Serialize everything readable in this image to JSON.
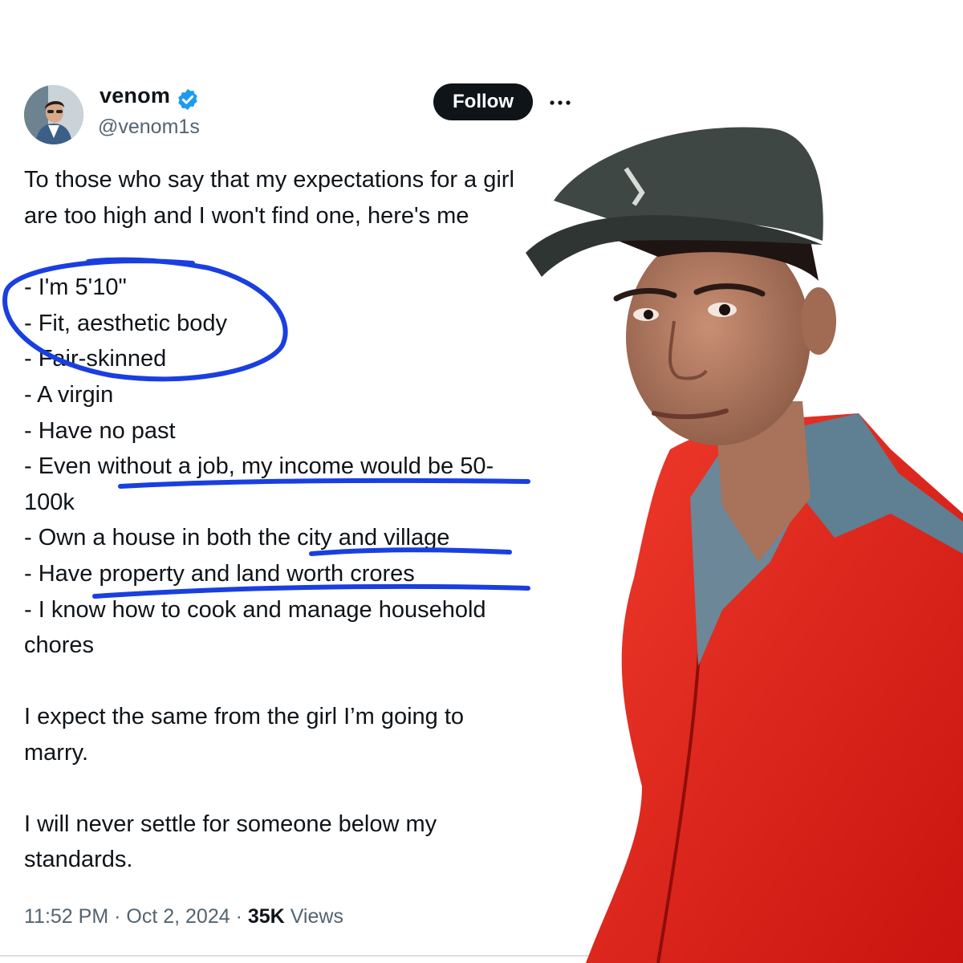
{
  "author": {
    "name": "venom",
    "handle": "@venom1s",
    "verified_icon": "verified-badge-icon",
    "avatar_icon": "profile-avatar"
  },
  "actions": {
    "follow_label": "Follow",
    "more_icon": "more-options-icon"
  },
  "tweet": {
    "lines": [
      "To those who say that my expectations for a girl",
      "are too high and I won't find one, here's me",
      "- I'm 5'10\"",
      "- Fit, aesthetic body",
      "- Fair-skinned",
      "- A virgin",
      "- Have no past",
      "- Even without a job, my income would be 50-",
      "100k",
      "- Own a house in both the city and village",
      "- Have property and land worth crores",
      "- I know how to cook and manage household",
      "chores",
      "I expect the same from the girl I’m going to",
      "marry.",
      "I will never settle for someone below my",
      "standards."
    ]
  },
  "meta": {
    "time": "11:52 PM",
    "separator": "·",
    "date": "Oct 2, 2024",
    "views_count": "35K",
    "views_label": "Views"
  },
  "overlay": {
    "photo": "man-in-cap-and-red-shirt-cutout",
    "annotations": "blue-marker-circle-and-underlines"
  },
  "colors": {
    "text": "#0f1419",
    "secondary": "#536471",
    "follow_bg": "#0f1419",
    "verified": "#1d9bf0",
    "marker": "#1a3fe0",
    "shirt": "#e3221a"
  }
}
